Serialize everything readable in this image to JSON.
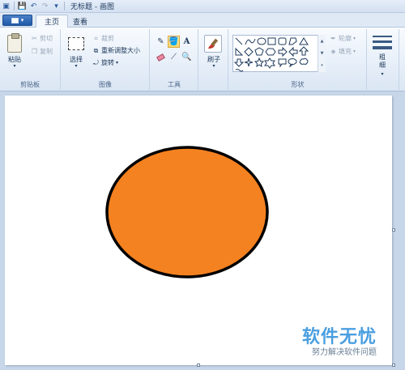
{
  "titlebar": {
    "title": "无标题 - 画图"
  },
  "tabs": {
    "home": "主页",
    "view": "查看"
  },
  "clipboard": {
    "paste": "粘贴",
    "cut": "剪切",
    "copy": "复制",
    "group": "剪贴板"
  },
  "image": {
    "select": "选择",
    "crop": "裁剪",
    "resize": "重新调整大小",
    "rotate": "旋转",
    "group": "图像"
  },
  "tools": {
    "group": "工具",
    "text_tool": "A"
  },
  "brushes": {
    "label": "刷子"
  },
  "shapes": {
    "outline": "轮廓",
    "fill": "填充",
    "group": "形状"
  },
  "size": {
    "label_line1": "粗",
    "label_line2": "细"
  },
  "drawing": {
    "ellipse_fill": "#F58220",
    "ellipse_stroke": "#000000"
  },
  "watermark": {
    "main": "软件无忧",
    "sub": "努力解决软件问题"
  },
  "colors": {
    "accent": "#1F5AA8",
    "ribbon_bg": "#E3ECF7",
    "workspace_bg": "#C7D6E8"
  }
}
